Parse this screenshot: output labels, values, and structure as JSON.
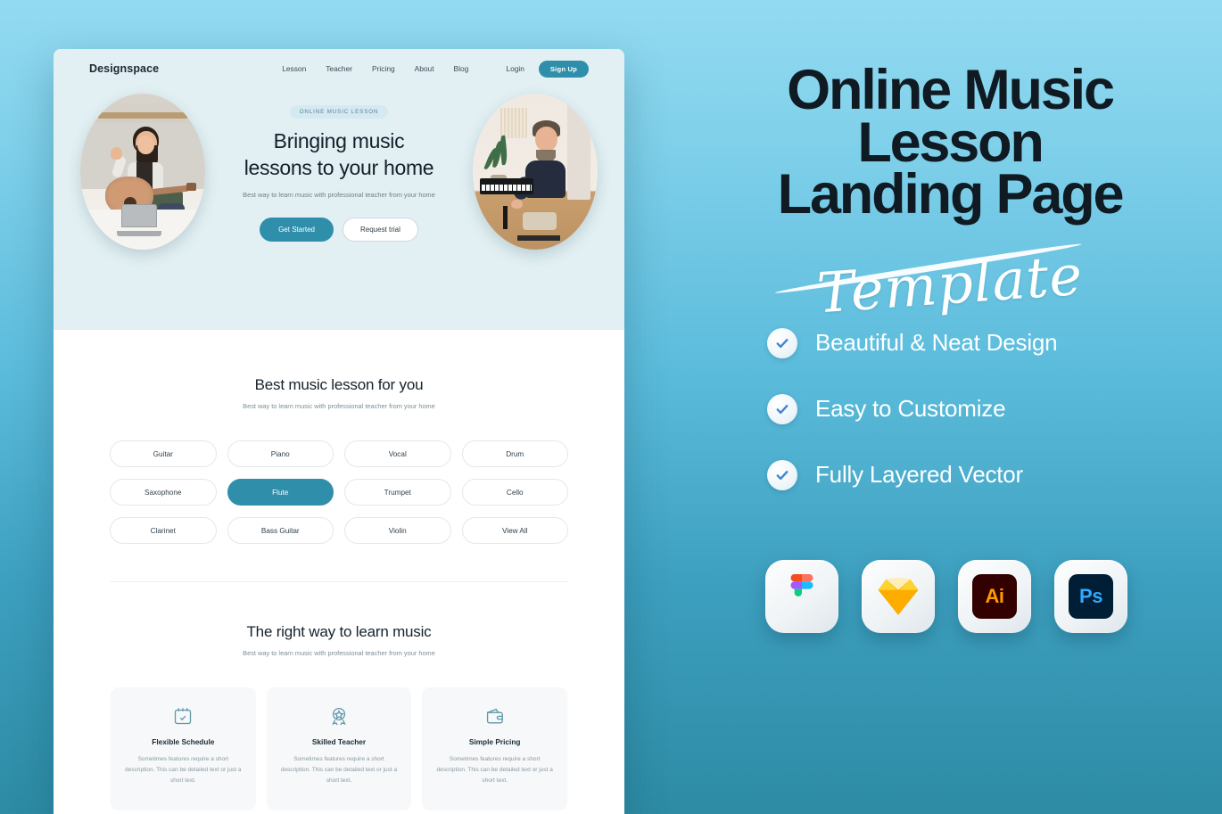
{
  "mockup": {
    "navbar": {
      "logo": "Designspace",
      "links": [
        {
          "label": "Lesson"
        },
        {
          "label": "Teacher"
        },
        {
          "label": "Pricing"
        },
        {
          "label": "About"
        },
        {
          "label": "Blog"
        }
      ],
      "login_label": "Login",
      "signup_label": "Sign Up"
    },
    "hero": {
      "badge": "ONLINE MUSIC LESSON",
      "title_line1": "Bringing music",
      "title_line2": "lessons to your home",
      "subtitle": "Best way to learn music with professional teacher from your home",
      "primary_button": "Get Started",
      "secondary_button": "Request trial",
      "image_left_alt": "woman-playing-guitar-with-laptop",
      "image_right_alt": "man-playing-keyboard-piano"
    },
    "lessons": {
      "title": "Best music lesson for you",
      "subtitle": "Best way to learn music with professional teacher from your home",
      "pills": [
        {
          "label": "Guitar",
          "active": false
        },
        {
          "label": "Piano",
          "active": false
        },
        {
          "label": "Vocal",
          "active": false
        },
        {
          "label": "Drum",
          "active": false
        },
        {
          "label": "Saxophone",
          "active": false
        },
        {
          "label": "Flute",
          "active": true
        },
        {
          "label": "Trumpet",
          "active": false
        },
        {
          "label": "Cello",
          "active": false
        },
        {
          "label": "Clarinet",
          "active": false
        },
        {
          "label": "Bass Guitar",
          "active": false
        },
        {
          "label": "Violin",
          "active": false
        },
        {
          "label": "View All",
          "active": false
        }
      ]
    },
    "features": {
      "title": "The right way to learn music",
      "subtitle": "Best way to learn music with professional teacher from your home",
      "cards": [
        {
          "icon": "calendar-check-icon",
          "title": "Flexible Schedule",
          "desc": "Sometimes features require a short description. This can be detailed text or just a short text."
        },
        {
          "icon": "award-badge-icon",
          "title": "Skilled Teacher",
          "desc": "Sometimes features require a short description. This can be detailed text or just a short text."
        },
        {
          "icon": "wallet-icon",
          "title": "Simple Pricing",
          "desc": "Sometimes features require a short description. This can be detailed text or just a short text."
        }
      ]
    }
  },
  "promo": {
    "title_line1": "Online Music",
    "title_line2": "Lesson",
    "title_line3": "Landing Page",
    "script_word": "Template",
    "bullets": [
      {
        "label": "Beautiful & Neat Design"
      },
      {
        "label": "Easy to Customize"
      },
      {
        "label": "Fully Layered Vector"
      }
    ],
    "apps": [
      {
        "name": "figma",
        "label": ""
      },
      {
        "name": "sketch",
        "label": ""
      },
      {
        "name": "illustrator",
        "label": "Ai"
      },
      {
        "name": "photoshop",
        "label": "Ps"
      }
    ]
  },
  "colors": {
    "accent_teal": "#2f8fab",
    "hero_bg": "#e2f0f3",
    "card_bg": "#f6f8f9",
    "promo_top": "#93daf1",
    "promo_bottom": "#2d8ba4",
    "heading_dark": "#101a22"
  }
}
